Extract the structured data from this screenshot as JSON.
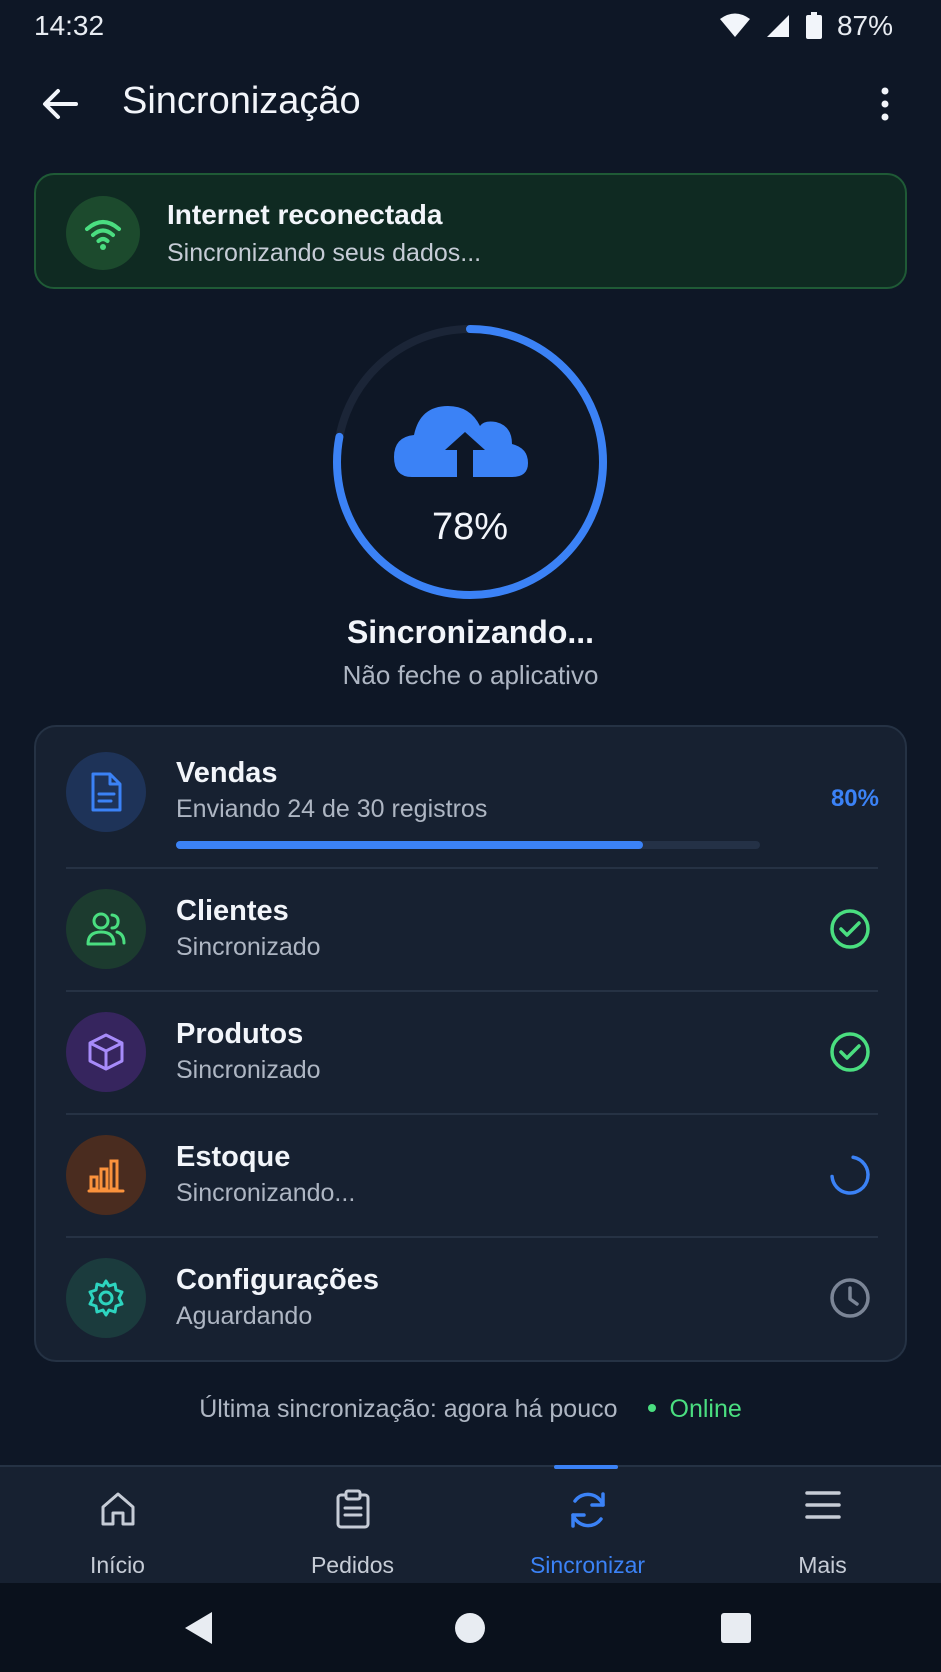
{
  "status_bar": {
    "time": "14:32",
    "battery": "87%"
  },
  "header": {
    "title": "Sincronização"
  },
  "banner": {
    "title": "Internet reconectada",
    "subtitle": "Sincronizando seus dados..."
  },
  "progress": {
    "percent_label": "78%",
    "value": 0.78,
    "title": "Sincronizando...",
    "subtitle": "Não feche o aplicativo"
  },
  "items": [
    {
      "title": "Vendas",
      "subtitle": "Enviando 24 de 30 registros",
      "percent_label": "80%",
      "progress": 0.8,
      "status": "in-progress",
      "icon": "document-icon",
      "color": "#3b82f6"
    },
    {
      "title": "Clientes",
      "subtitle": "Sincronizado",
      "status": "done",
      "icon": "users-icon",
      "color": "#4ade80"
    },
    {
      "title": "Produtos",
      "subtitle": "Sincronizado",
      "status": "done",
      "icon": "box-icon",
      "color": "#a78bfa"
    },
    {
      "title": "Estoque",
      "subtitle": "Sincronizando...",
      "status": "syncing",
      "icon": "bar-chart-icon",
      "color": "#fb923c"
    },
    {
      "title": "Configurações",
      "subtitle": "Aguardando",
      "status": "waiting",
      "icon": "gear-icon",
      "color": "#2dd4bf"
    }
  ],
  "footer": {
    "last_sync": "Última sincronização: agora há pouco",
    "online": "Online"
  },
  "bottom_nav": [
    {
      "label": "Início",
      "icon": "home-icon"
    },
    {
      "label": "Pedidos",
      "icon": "clipboard-icon"
    },
    {
      "label": "Sincronizar",
      "icon": "sync-icon",
      "active": true
    },
    {
      "label": "Mais",
      "icon": "menu-icon"
    }
  ],
  "colors": {
    "accent": "#3b82f6",
    "success": "#4ade80",
    "background": "#0e1726",
    "card": "#172131"
  }
}
